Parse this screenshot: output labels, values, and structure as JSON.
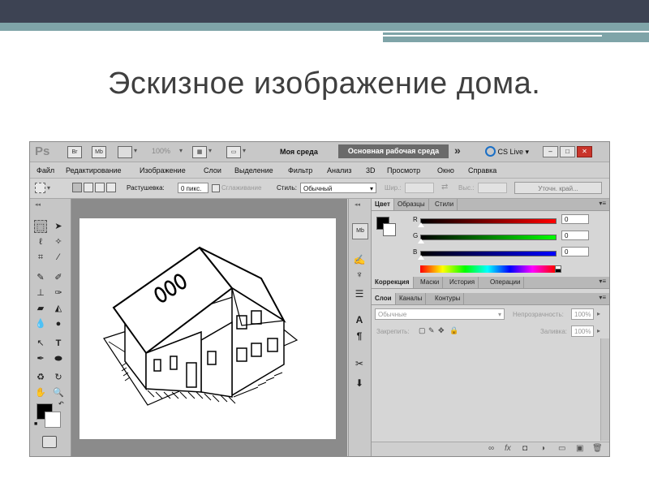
{
  "slide": {
    "title": "Эскизное изображение дома."
  },
  "app": {
    "logo": "Ps",
    "app_icons": [
      "Br",
      "Mb"
    ],
    "zoom": "100%",
    "workspace_1": "Моя среда",
    "workspace_2": "Основная рабочая среда",
    "more": "»",
    "cs_live": "CS Live",
    "window_buttons": [
      "–",
      "□",
      "✕"
    ]
  },
  "menu": {
    "items": [
      "Файл",
      "Редактирование",
      "Изображение",
      "Слои",
      "Выделение",
      "Фильтр",
      "Анализ",
      "3D",
      "Просмотр",
      "Окно",
      "Справка"
    ]
  },
  "options": {
    "feather_label": "Растушевка:",
    "feather_value": "0 пикс.",
    "smoothing_label": "Сглаживание",
    "style_label": "Стиль:",
    "style_value": "Обычный",
    "width_label": "Шир.:",
    "height_label": "Выс.:",
    "refine_button": "Уточн. край..."
  },
  "color_panel": {
    "tabs": [
      "Цвет",
      "Образцы",
      "Стили"
    ],
    "channels": [
      {
        "name": "R",
        "value": "0",
        "color": "#ff0000"
      },
      {
        "name": "G",
        "value": "0",
        "color": "#00ff00"
      },
      {
        "name": "B",
        "value": "0",
        "color": "#0000ff"
      }
    ]
  },
  "adjust_panel": {
    "tabs": [
      "Коррекция",
      "Маски",
      "История",
      "Операции"
    ]
  },
  "layers_panel": {
    "tabs": [
      "Слои",
      "Каналы",
      "Контуры"
    ],
    "blend_mode": "Обычные",
    "opacity_label": "Непрозрачность:",
    "opacity_value": "100%",
    "lock_label": "Закрепить:",
    "fill_label": "Заливка:",
    "fill_value": "100%",
    "bottom_icons": [
      "∞",
      "fx",
      "◘",
      "◑",
      "▭",
      "▣",
      "🗑"
    ]
  },
  "colors": {
    "slide_band": "#3d4353",
    "slide_accent": "#7fa4a8",
    "active_workspace": "#6a6a6a",
    "close_button": "#c9342a"
  }
}
